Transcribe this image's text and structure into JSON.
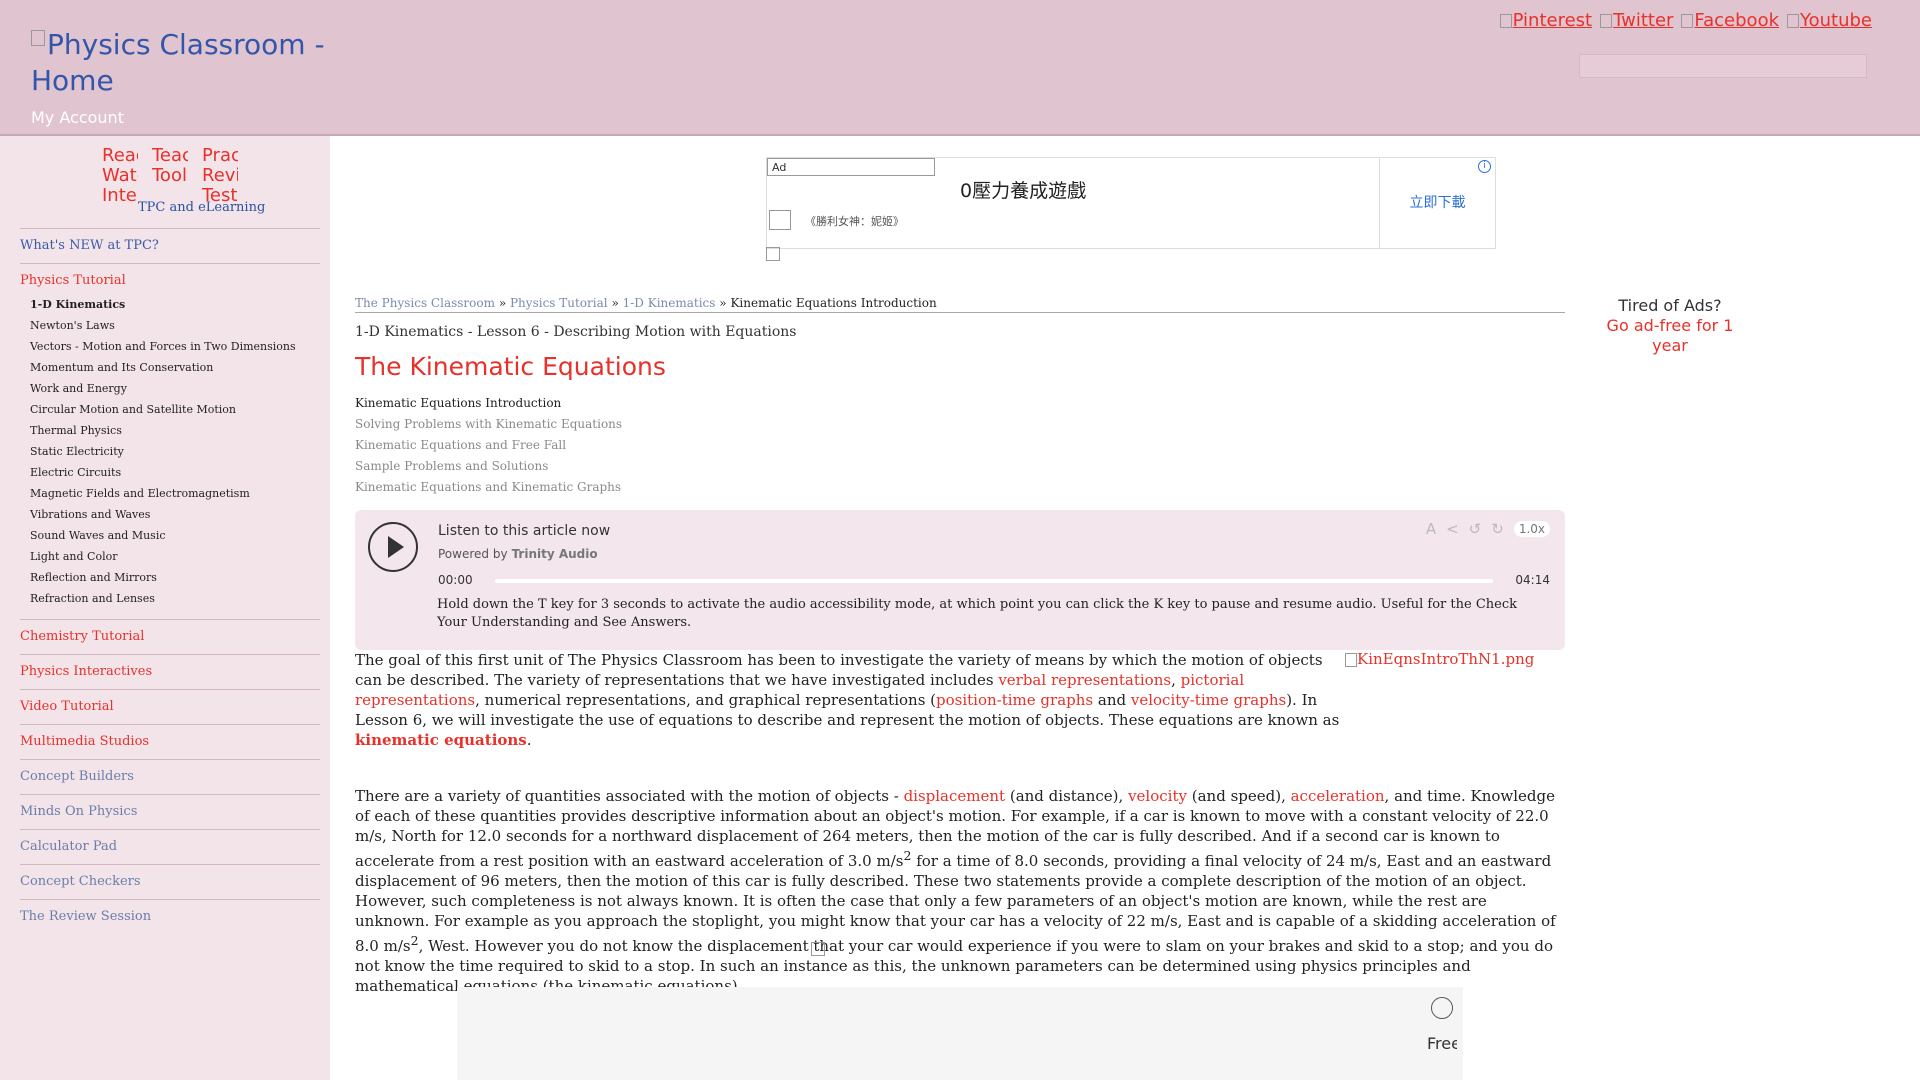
{
  "header": {
    "logo_alt": "Physics Classroom - Home",
    "my_account": "My Account",
    "social": [
      "Pinterest",
      "Twitter",
      "Facebook",
      "Youtube"
    ]
  },
  "sidebar": {
    "icons": [
      "Read Watch Interact",
      "Teacher Tools",
      "Practice Review Test"
    ],
    "icon_short": [
      "Reac Watc Inter",
      "Teac Tools",
      "Prac Revi Test"
    ],
    "tpc_elearning": "TPC and eLearning",
    "sections": [
      {
        "label": "What's NEW at TPC?",
        "style": "blue"
      },
      {
        "label": "Physics Tutorial",
        "style": "red"
      },
      {
        "label": "Chemistry Tutorial",
        "style": "red"
      },
      {
        "label": "Physics Interactives",
        "style": "red"
      },
      {
        "label": "Video Tutorial",
        "style": "red"
      },
      {
        "label": "Multimedia Studios",
        "style": "red"
      },
      {
        "label": "Concept Builders",
        "style": "gray"
      },
      {
        "label": "Minds On Physics",
        "style": "gray"
      },
      {
        "label": "Calculator Pad",
        "style": "gray"
      },
      {
        "label": "Concept Checkers",
        "style": "gray"
      },
      {
        "label": "The Review Session",
        "style": "gray"
      }
    ],
    "tutorial_items": [
      "1-D Kinematics",
      "Newton's Laws",
      "Vectors - Motion and Forces in Two Dimensions",
      "Momentum and Its Conservation",
      "Work and Energy",
      "Circular Motion and Satellite Motion",
      "Thermal Physics",
      "Static Electricity",
      "Electric Circuits",
      "Magnetic Fields and Electromagnetism",
      "Vibrations and Waves",
      "Sound Waves and Music",
      "Light and Color",
      "Reflection and Mirrors",
      "Refraction and Lenses"
    ]
  },
  "ad_top": {
    "label": "Ad",
    "title": "0壓力養成遊戲",
    "subtitle": "《勝利女神：妮姬》",
    "cta": "立即下載",
    "info": "i"
  },
  "breadcrumb": {
    "items": [
      "The Physics Classroom",
      "Physics Tutorial",
      "1-D Kinematics"
    ],
    "current": "Kinematic Equations Introduction",
    "sep": "»"
  },
  "lesson_heading": "1-D Kinematics - Lesson 6 - Describing Motion with Equations",
  "page_title": "The Kinematic Equations",
  "lesson_list": [
    "Kinematic Equations Introduction",
    "Solving Problems with Kinematic Equations",
    "Kinematic Equations and Free Fall",
    "Sample Problems and Solutions",
    "Kinematic Equations and Kinematic Graphs"
  ],
  "audio": {
    "listen": "Listen to this article now",
    "powered_by": "Powered by",
    "brand": "Trinity Audio",
    "time_start": "00:00",
    "time_end": "04:14",
    "speed": "1.0x",
    "note": "Hold down the T key for 3 seconds to activate the audio accessibility mode, at which point you can click the K key to pause and resume audio. Useful for the Check Your Understanding and See Answers.",
    "progress": 0
  },
  "content": {
    "p1_a": "The goal of this first unit of The Physics Classroom has been to investigate the variety of means by which the motion of objects can be described. The variety of representations that we have investigated includes ",
    "link_verbal": "verbal representations",
    "p1_b": ", ",
    "link_pictorial": "pictorial representations",
    "p1_c": ", numerical representations, and graphical representations (",
    "link_pt": "position-time graphs",
    "p1_d": " and ",
    "link_vt": "velocity-time graphs",
    "p1_e": "). In Lesson 6, we will investigate the use of equations to describe and represent the motion of objects. These equations are known as ",
    "kin": "kinematic equations",
    "p1_f": ".",
    "image_alt": "KinEqnsIntroThN1.png",
    "p2_a": "There are a variety of quantities associated with the motion of objects - ",
    "link_disp": "displacement",
    "p2_b": " (and distance), ",
    "link_vel": "velocity",
    "p2_c": " (and speed), ",
    "link_acc": "acceleration",
    "p2_d": ", and time. Knowledge of each of these quantities provides descriptive information about an object's motion. For example, if a car is known to move with a constant velocity of 22.0 m/s, North for 12.0 seconds for a northward displacement of 264 meters, then the motion of the car is fully described. And if a second car is known to accelerate from a rest position with an eastward acceleration of 3.0 m/s",
    "p2_e": " for a time of 8.0 seconds, providing a final velocity of 24 m/s, East and an eastward displacement of 96 meters, then the motion of this car is fully described. These two statements provide a complete description of the motion of an object. However, such completeness is not always known. It is often the case that only a few parameters of an object's motion are known, while the rest are unknown. For example as you approach the stoplight, you might know that your car has a velocity of 22 m/s, East and is capable of a skidding acceleration of 8.0 m/s",
    "p2_f": ", West. However you do not know the displacement that your car would experience if you were to slam on your brakes and skid to a stop; and you do not know the time required to skid to a stop. In such an instance as this, the unknown parameters can be determined using physics principles and mathematical equations (the kinematic equations).",
    "sup": "2"
  },
  "tired_ads": {
    "title": "Tired of Ads?",
    "link": "Go ad-free for 1 year"
  },
  "bottom_ad": {
    "free_alt": "Free"
  }
}
